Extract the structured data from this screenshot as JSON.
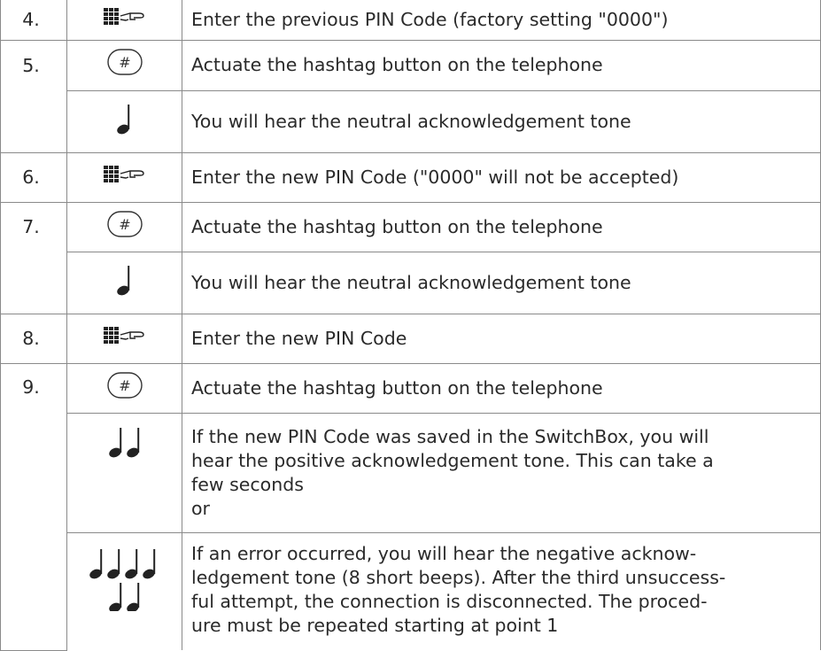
{
  "rows": [
    {
      "num": "4.",
      "icon": "keypad-icon",
      "text": "Enter the previous PIN Code (factory setting \"0000\")"
    },
    {
      "num": "5.",
      "icon": "hash-button-icon",
      "text": "Actuate the hashtag button on the telephone"
    },
    {
      "num": "",
      "icon": "one-tone-icon",
      "text": "You will hear the neutral acknowledgement tone"
    },
    {
      "num": "6.",
      "icon": "keypad-icon",
      "text": "Enter the new PIN Code (\"0000\" will not be accepted)"
    },
    {
      "num": "7.",
      "icon": "hash-button-icon",
      "text": "Actuate the hashtag button on the telephone"
    },
    {
      "num": "",
      "icon": "one-tone-icon",
      "text": "You will hear the neutral acknowledgement tone"
    },
    {
      "num": "8.",
      "icon": "keypad-icon",
      "text": "Enter the new PIN Code"
    },
    {
      "num": "9.",
      "icon": "hash-button-icon",
      "text": "Actuate the hashtag button on the telephone"
    },
    {
      "num": "",
      "icon": "two-tones-icon",
      "lines": [
        "If the new PIN Code was saved in the SwitchBox, you will",
        "hear the positive acknowledgement tone. This can take a",
        "few seconds",
        "or"
      ]
    },
    {
      "num": "",
      "icon": "six-tones-icon",
      "lines": [
        "If an error occurred, you will hear the negative acknow-",
        "ledgement tone (8 short beeps). After the third unsuccess-",
        "ful attempt, the connection is disconnected. The proced-",
        "ure must be repeated starting at point 1"
      ]
    }
  ]
}
